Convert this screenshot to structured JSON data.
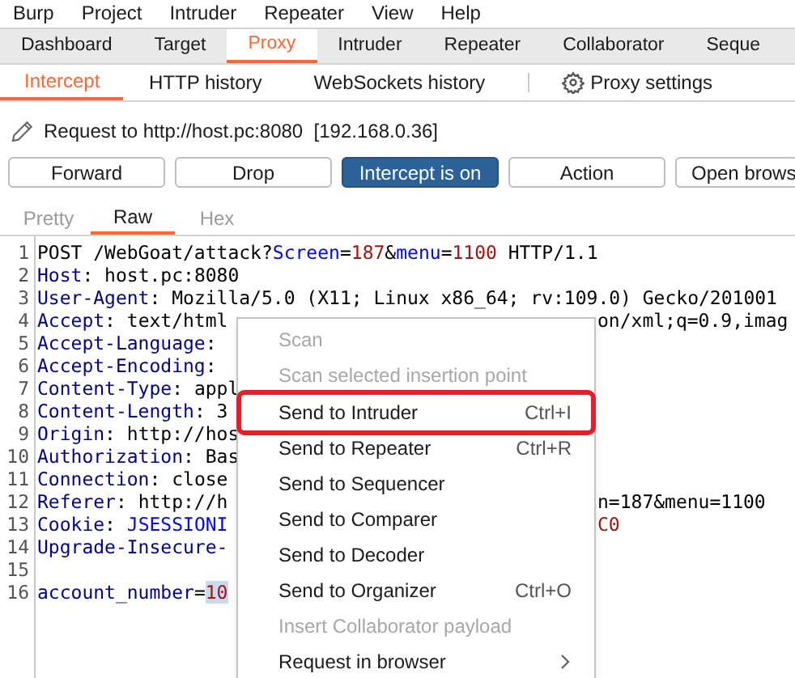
{
  "menu_bar": [
    "Burp",
    "Project",
    "Intruder",
    "Repeater",
    "View",
    "Help"
  ],
  "tabs": [
    {
      "label": "Dashboard",
      "selected": false
    },
    {
      "label": "Target",
      "selected": false
    },
    {
      "label": "Proxy",
      "selected": true
    },
    {
      "label": "Intruder",
      "selected": false
    },
    {
      "label": "Repeater",
      "selected": false
    },
    {
      "label": "Collaborator",
      "selected": false
    },
    {
      "label": "Seque",
      "selected": false
    }
  ],
  "sub_tabs": [
    {
      "label": "Intercept",
      "selected": true
    },
    {
      "label": "HTTP history",
      "selected": false
    },
    {
      "label": "WebSockets history",
      "selected": false
    }
  ],
  "proxy_settings": "Proxy settings",
  "request_info": "Request to http://host.pc:8080  [192.168.0.36]",
  "buttons": [
    {
      "label": "Forward",
      "active": false
    },
    {
      "label": "Drop",
      "active": false
    },
    {
      "label": "Intercept is on",
      "active": true
    },
    {
      "label": "Action",
      "active": false
    },
    {
      "label": "Open brows",
      "active": false
    }
  ],
  "view_tabs": [
    {
      "label": "Pretty",
      "selected": false
    },
    {
      "label": "Raw",
      "selected": true
    },
    {
      "label": "Hex",
      "selected": false
    }
  ],
  "editor_lines": [
    {
      "number": "1",
      "left": [
        {
          "kind": "plain",
          "text": "POST /WebGoat/attack?"
        },
        {
          "kind": "param",
          "text": "Screen"
        },
        {
          "kind": "plain",
          "text": "="
        },
        {
          "kind": "value",
          "text": "187"
        },
        {
          "kind": "plain",
          "text": "&"
        },
        {
          "kind": "param",
          "text": "menu"
        },
        {
          "kind": "plain",
          "text": "="
        },
        {
          "kind": "value",
          "text": "1100"
        },
        {
          "kind": "plain",
          "text": " HTTP/1.1"
        }
      ]
    },
    {
      "number": "2",
      "left": [
        {
          "kind": "name",
          "text": "Host"
        },
        {
          "kind": "plain",
          "text": ": host.pc:8080"
        }
      ]
    },
    {
      "number": "3",
      "left": [
        {
          "kind": "name",
          "text": "User-Agent"
        },
        {
          "kind": "plain",
          "text": ": Mozilla/5.0 (X11; Linux x86_64; rv:109.0) Gecko/201001"
        }
      ]
    },
    {
      "number": "4",
      "left": [
        {
          "kind": "name",
          "text": "Accept"
        },
        {
          "kind": "plain",
          "text": ": text/html"
        }
      ],
      "right": [
        {
          "kind": "plain",
          "text": "on/xml;q=0.9,imag"
        }
      ]
    },
    {
      "number": "5",
      "left": [
        {
          "kind": "name",
          "text": "Accept-Language"
        },
        {
          "kind": "plain",
          "text": ":"
        }
      ]
    },
    {
      "number": "6",
      "left": [
        {
          "kind": "name",
          "text": "Accept-Encoding"
        },
        {
          "kind": "plain",
          "text": ":"
        }
      ]
    },
    {
      "number": "7",
      "left": [
        {
          "kind": "name",
          "text": "Content-Type"
        },
        {
          "kind": "plain",
          "text": ": appl"
        }
      ]
    },
    {
      "number": "8",
      "left": [
        {
          "kind": "name",
          "text": "Content-Length"
        },
        {
          "kind": "plain",
          "text": ": 3"
        }
      ]
    },
    {
      "number": "9",
      "left": [
        {
          "kind": "name",
          "text": "Origin"
        },
        {
          "kind": "plain",
          "text": ": http://hos"
        }
      ]
    },
    {
      "number": "10",
      "left": [
        {
          "kind": "name",
          "text": "Authorization"
        },
        {
          "kind": "plain",
          "text": ": Bas"
        }
      ]
    },
    {
      "number": "11",
      "left": [
        {
          "kind": "name",
          "text": "Connection"
        },
        {
          "kind": "plain",
          "text": ": close"
        }
      ]
    },
    {
      "number": "12",
      "left": [
        {
          "kind": "name",
          "text": "Referer"
        },
        {
          "kind": "plain",
          "text": ": http://h"
        }
      ],
      "right": [
        {
          "kind": "plain",
          "text": "n=187&menu=1100"
        }
      ]
    },
    {
      "number": "13",
      "left": [
        {
          "kind": "name",
          "text": "Cookie"
        },
        {
          "kind": "plain",
          "text": ": "
        },
        {
          "kind": "param",
          "text": "JSESSIONI"
        }
      ],
      "right": [
        {
          "kind": "value",
          "text": "C0"
        }
      ]
    },
    {
      "number": "14",
      "left": [
        {
          "kind": "name",
          "text": "Upgrade-Insecure-"
        }
      ]
    },
    {
      "number": "15"
    },
    {
      "number": "16",
      "left": [
        {
          "kind": "name",
          "text": "account_number"
        },
        {
          "kind": "plain",
          "text": "="
        },
        {
          "kind": "value",
          "text": "10",
          "selected": true
        }
      ]
    }
  ],
  "context_menu": [
    {
      "kind": "item",
      "label": "Scan",
      "disabled": true,
      "highlighted": false
    },
    {
      "kind": "item",
      "label": "Scan selected insertion point",
      "disabled": true,
      "highlighted": false
    },
    {
      "kind": "separator"
    },
    {
      "kind": "item",
      "label": "Send to Intruder",
      "shortcut": "Ctrl+I",
      "disabled": false,
      "highlighted": true
    },
    {
      "kind": "item",
      "label": "Send to Repeater",
      "shortcut": "Ctrl+R",
      "disabled": false,
      "highlighted": false
    },
    {
      "kind": "item",
      "label": "Send to Sequencer",
      "disabled": false,
      "highlighted": false
    },
    {
      "kind": "item",
      "label": "Send to Comparer",
      "disabled": false,
      "highlighted": false
    },
    {
      "kind": "item",
      "label": "Send to Decoder",
      "disabled": false,
      "highlighted": false
    },
    {
      "kind": "item",
      "label": "Send to Organizer",
      "shortcut": "Ctrl+O",
      "disabled": false,
      "highlighted": false
    },
    {
      "kind": "item",
      "label": "Insert Collaborator payload",
      "disabled": true,
      "highlighted": false
    },
    {
      "kind": "submenu",
      "label": "Request in browser",
      "disabled": false,
      "highlighted": false
    }
  ]
}
